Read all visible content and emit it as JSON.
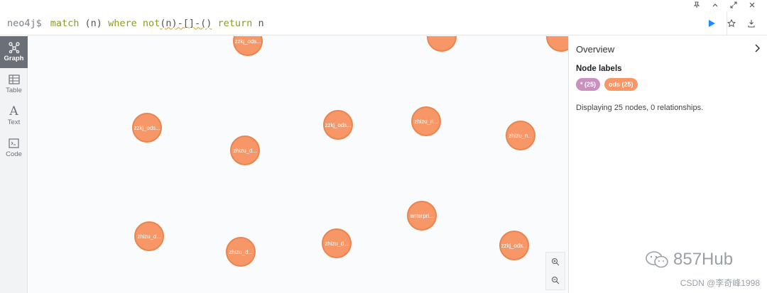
{
  "window_controls": [
    "pin-icon",
    "collapse-icon",
    "expand-icon",
    "close-icon"
  ],
  "editor": {
    "prompt": "neo4j$",
    "query_parts": {
      "kw_match": "match",
      "p1": " (n) ",
      "kw_where": "where",
      "sp": " ",
      "kw_not": "not",
      "squiggle": "(n)-[]-()",
      "sp2": " ",
      "kw_return": "return",
      "tail": " n"
    },
    "run_icon": "play-icon",
    "favorite_icon": "star-icon",
    "download_icon": "download-icon"
  },
  "sidebar": {
    "items": [
      {
        "label": "Graph",
        "icon": "graph-icon",
        "active": true
      },
      {
        "label": "Table",
        "icon": "table-icon",
        "active": false
      },
      {
        "label": "Text",
        "icon": "text-icon",
        "active": false
      },
      {
        "label": "Code",
        "icon": "code-icon",
        "active": false
      }
    ]
  },
  "nodes": [
    "zzkj_ods...",
    "zzkj_ods...",
    "zhizu_ri...",
    "zhizu_n...",
    "zhizu_d...",
    "enterpri...",
    "zhizu_d...",
    "zhizu_d...",
    "zhizu_d...",
    "zzkj_ods...",
    "zzkj_ods..."
  ],
  "zoom": {
    "in_icon": "zoom-in-icon",
    "out_icon": "zoom-out-icon"
  },
  "overview": {
    "title": "Overview",
    "node_labels_heading": "Node labels",
    "label_all": "* (25)",
    "label_ods": "ods (25)",
    "status": "Displaying 25 nodes, 0 relationships."
  },
  "watermark": "857Hub",
  "credit": "CSDN @李奇峰1998",
  "colors": {
    "node": "#f79767",
    "node_border": "#e9854f",
    "pill_all": "#c990c0",
    "run": "#1a8cff"
  }
}
